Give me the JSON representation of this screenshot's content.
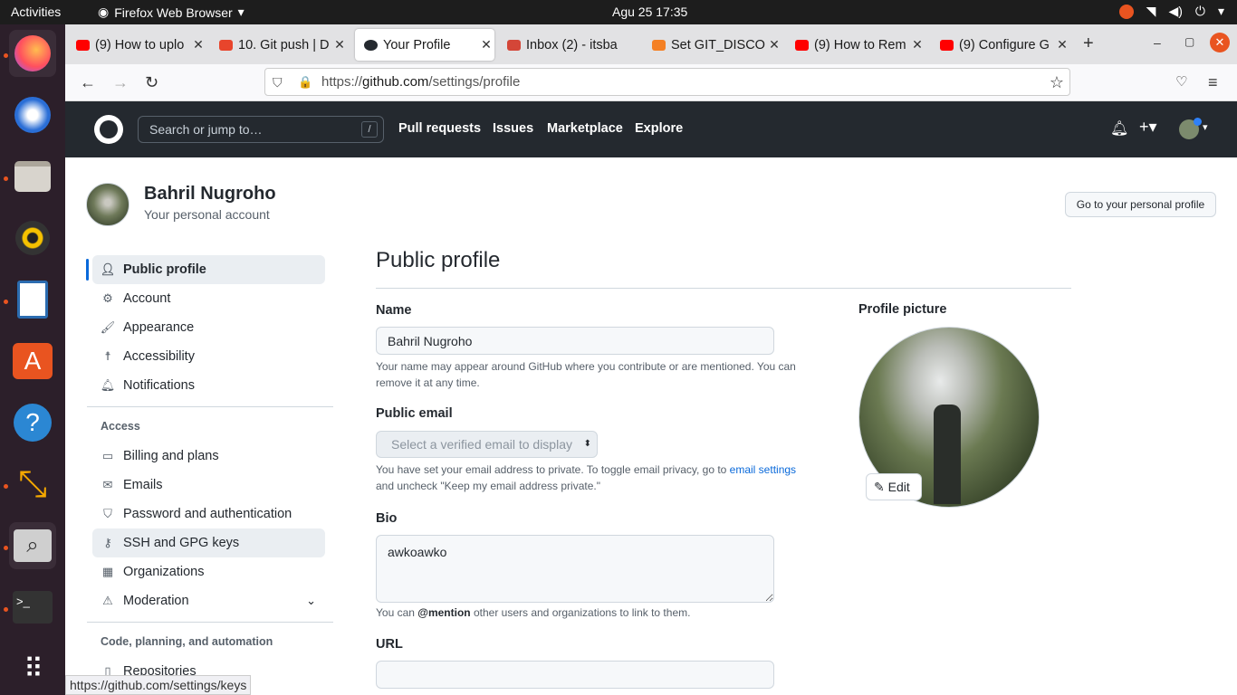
{
  "system": {
    "activities": "Activities",
    "app_name": "Firefox Web Browser",
    "clock": "Agu 25  17:35"
  },
  "tabs": [
    {
      "label": "(9) How to uplo",
      "color": "#ff0000"
    },
    {
      "label": "10. Git push | D",
      "color": "#e8452c"
    },
    {
      "label": "Your Profile",
      "color": "#24292f"
    },
    {
      "label": "Inbox (2) - itsba",
      "color": "#d44638"
    },
    {
      "label": "Set GIT_DISCO",
      "color": "#f48024"
    },
    {
      "label": "(9) How to Rem",
      "color": "#ff0000"
    },
    {
      "label": "(9) Configure G",
      "color": "#ff0000"
    }
  ],
  "url": {
    "prefix": "https://",
    "host": "github.com",
    "path": "/settings/profile"
  },
  "github": {
    "search_placeholder": "Search or jump to…",
    "slash": "/",
    "nav": [
      "Pull requests",
      "Issues",
      "Marketplace",
      "Explore"
    ]
  },
  "account": {
    "name": "Bahril Nugroho",
    "subtitle": "Your personal account",
    "go_profile": "Go to your personal profile"
  },
  "sidebar": {
    "items": [
      {
        "label": "Public profile",
        "icon": "person-icon"
      },
      {
        "label": "Account",
        "icon": "gear-icon"
      },
      {
        "label": "Appearance",
        "icon": "paintbrush-icon"
      },
      {
        "label": "Accessibility",
        "icon": "accessibility-icon"
      },
      {
        "label": "Notifications",
        "icon": "bell-icon"
      }
    ],
    "access_header": "Access",
    "access_items": [
      {
        "label": "Billing and plans"
      },
      {
        "label": "Emails"
      },
      {
        "label": "Password and authentication"
      },
      {
        "label": "SSH and GPG keys"
      },
      {
        "label": "Organizations"
      },
      {
        "label": "Moderation"
      }
    ],
    "code_header": "Code, planning, and automation",
    "code_items": [
      {
        "label": "Repositories"
      }
    ]
  },
  "profile": {
    "title": "Public profile",
    "name_label": "Name",
    "name_value": "Bahril Nugroho",
    "name_note": "Your name may appear around GitHub where you contribute or are mentioned. You can remove it at any time.",
    "email_label": "Public email",
    "email_placeholder": "Select a verified email to display",
    "email_note_a": "You have set your email address to private. To toggle email privacy, go to ",
    "email_note_link": "email settings",
    "email_note_b": " and uncheck \"Keep my email address private.\"",
    "bio_label": "Bio",
    "bio_value": "awkoawko",
    "bio_note_a": "You can ",
    "bio_note_mention": "@mention",
    "bio_note_b": " other users and organizations to link to them.",
    "url_label": "URL",
    "picture_label": "Profile picture",
    "edit_label": "Edit"
  },
  "status_url": "https://github.com/settings/keys"
}
